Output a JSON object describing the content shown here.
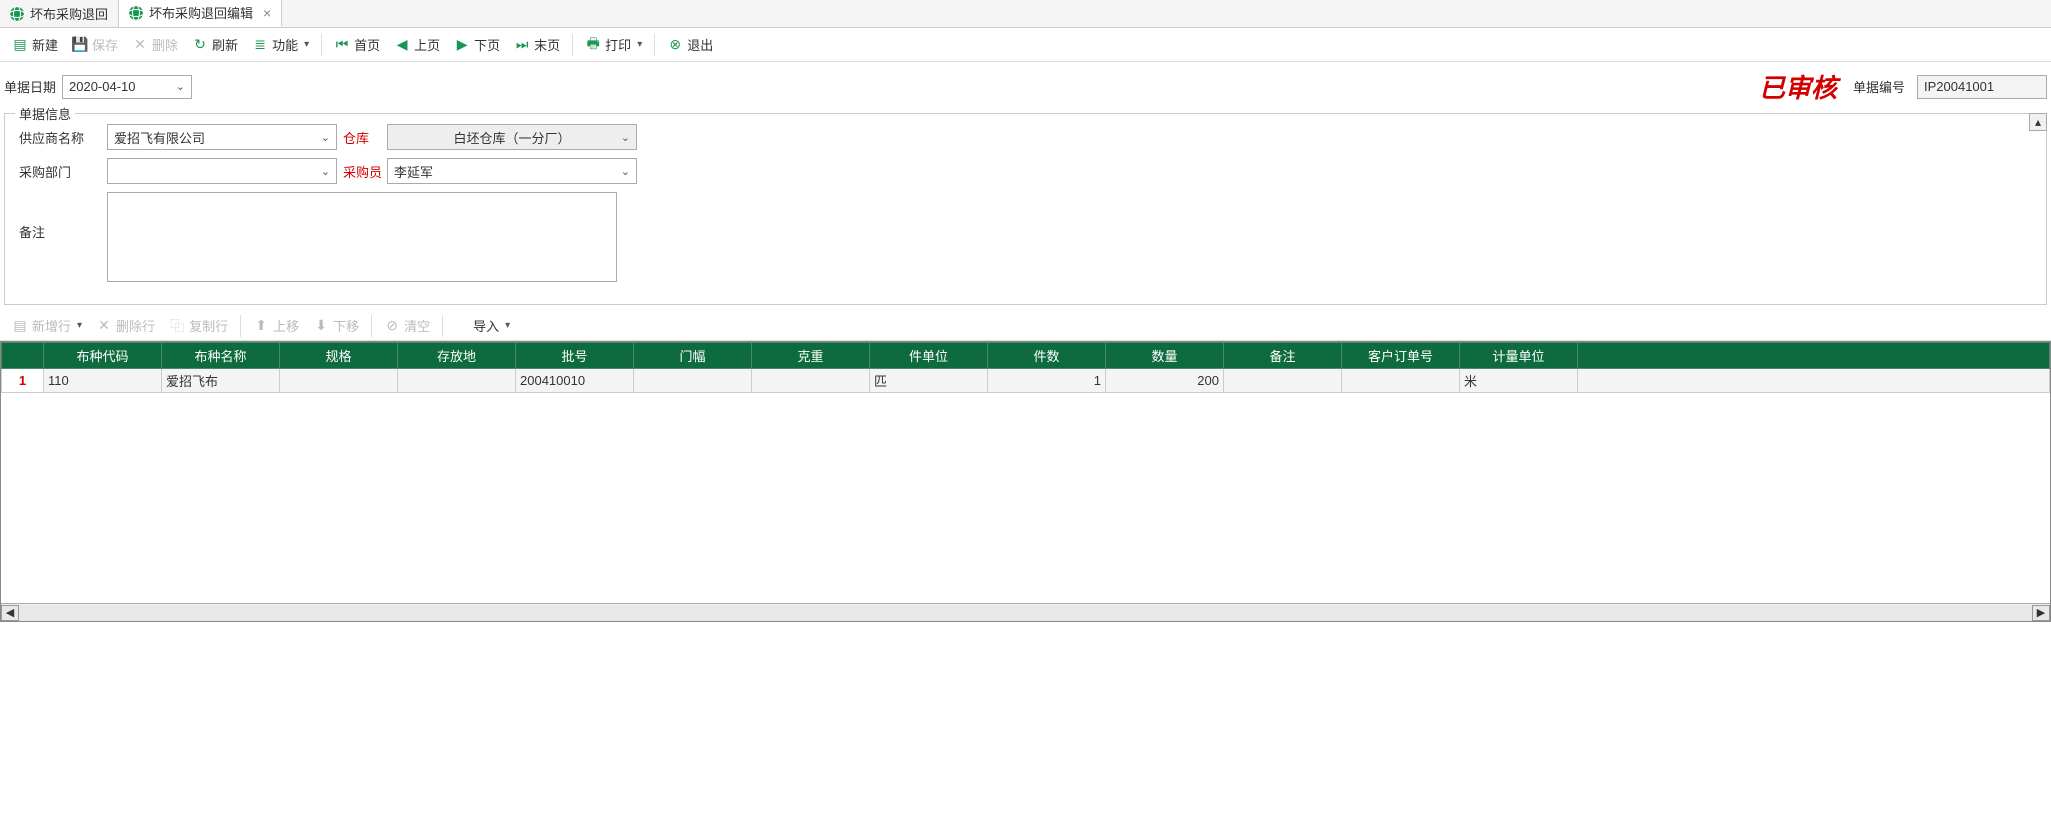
{
  "tabs": [
    {
      "label": "坏布采购退回",
      "closable": false
    },
    {
      "label": "坏布采购退回编辑",
      "closable": true
    }
  ],
  "toolbar": {
    "new": "新建",
    "save": "保存",
    "delete": "删除",
    "refresh": "刷新",
    "function": "功能",
    "first": "首页",
    "prev": "上页",
    "next": "下页",
    "last": "末页",
    "print": "打印",
    "exit": "退出"
  },
  "header": {
    "date_label": "单据日期",
    "date_value": "2020-04-10",
    "stamp": "已审核",
    "docnum_label": "单据编号",
    "docnum_value": "IP20041001"
  },
  "form": {
    "legend": "单据信息",
    "supplier_label": "供应商名称",
    "supplier_value": "爱招飞有限公司",
    "warehouse_label": "仓库",
    "warehouse_value": "白坯仓库（一分厂）",
    "dept_label": "采购部门",
    "dept_value": "",
    "buyer_label": "采购员",
    "buyer_value": "李延军",
    "remark_label": "备注",
    "remark_value": ""
  },
  "sub_toolbar": {
    "addrow": "新增行",
    "delrow": "删除行",
    "copyrow": "复制行",
    "moveup": "上移",
    "movedown": "下移",
    "clear": "清空",
    "import": "导入"
  },
  "table": {
    "columns": [
      "布种代码",
      "布种名称",
      "规格",
      "存放地",
      "批号",
      "门幅",
      "克重",
      "件单位",
      "件数",
      "数量",
      "备注",
      "客户订单号",
      "计量单位"
    ],
    "rows": [
      {
        "num": "1",
        "code": "110",
        "name": "爱招飞布",
        "spec": "",
        "loc": "",
        "batch": "200410010",
        "width": "",
        "gram": "",
        "pcunit": "匹",
        "pcs": "1",
        "qty": "200",
        "remark": "",
        "ordno": "",
        "unit": "米"
      }
    ]
  }
}
